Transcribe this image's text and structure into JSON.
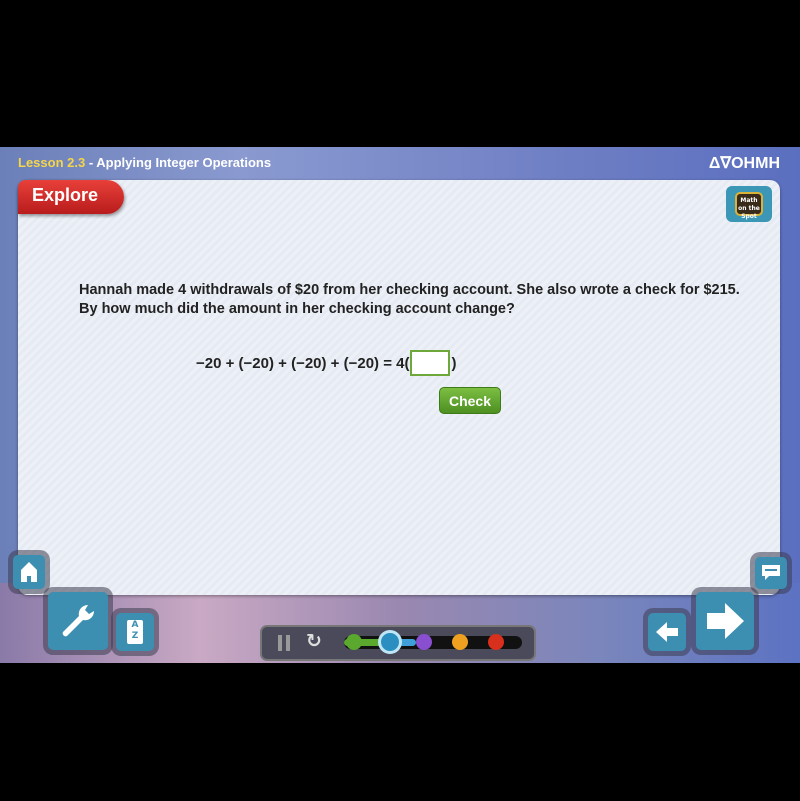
{
  "header": {
    "lesson": "Lesson 2.3",
    "separator": " - ",
    "title": "Applying Integer Operations",
    "brand": "Δ∇OHMH"
  },
  "panel": {
    "tab": "Explore",
    "math_on_the_spot": "Math on the Spot",
    "question_line1": "Hannah made 4 withdrawals of $20 from her checking account. She also wrote a check for $215.",
    "question_line2": "By how much did the amount in her checking account change?",
    "equation_left": "−20 + (−20) + (−20) + (−20) = 4(",
    "equation_right": ")",
    "answer_value": "",
    "check_label": "Check"
  },
  "controls": {
    "home": "home-icon",
    "tools": "wrench-icon",
    "glossary_label": "A Z",
    "comment": "comment-icon",
    "back": "arrow-left-icon",
    "next": "arrow-right-icon",
    "progress_steps": [
      "#5aa82e",
      "#3fa6d8",
      "#8a4fd0",
      "#f0a020",
      "#d8301c"
    ],
    "progress_current_step": 2
  }
}
